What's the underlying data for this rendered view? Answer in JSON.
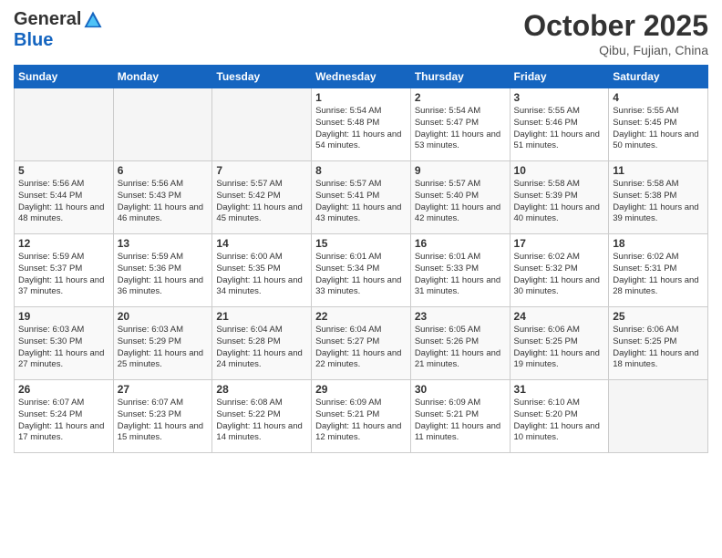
{
  "header": {
    "logo_line1": "General",
    "logo_line2": "Blue",
    "month": "October 2025",
    "location": "Qibu, Fujian, China"
  },
  "days_of_week": [
    "Sunday",
    "Monday",
    "Tuesday",
    "Wednesday",
    "Thursday",
    "Friday",
    "Saturday"
  ],
  "weeks": [
    [
      {
        "day": "",
        "empty": true
      },
      {
        "day": "",
        "empty": true
      },
      {
        "day": "",
        "empty": true
      },
      {
        "day": "1",
        "sunrise": "5:54 AM",
        "sunset": "5:48 PM",
        "daylight": "11 hours and 54 minutes."
      },
      {
        "day": "2",
        "sunrise": "5:54 AM",
        "sunset": "5:47 PM",
        "daylight": "11 hours and 53 minutes."
      },
      {
        "day": "3",
        "sunrise": "5:55 AM",
        "sunset": "5:46 PM",
        "daylight": "11 hours and 51 minutes."
      },
      {
        "day": "4",
        "sunrise": "5:55 AM",
        "sunset": "5:45 PM",
        "daylight": "11 hours and 50 minutes."
      }
    ],
    [
      {
        "day": "5",
        "sunrise": "5:56 AM",
        "sunset": "5:44 PM",
        "daylight": "11 hours and 48 minutes."
      },
      {
        "day": "6",
        "sunrise": "5:56 AM",
        "sunset": "5:43 PM",
        "daylight": "11 hours and 46 minutes."
      },
      {
        "day": "7",
        "sunrise": "5:57 AM",
        "sunset": "5:42 PM",
        "daylight": "11 hours and 45 minutes."
      },
      {
        "day": "8",
        "sunrise": "5:57 AM",
        "sunset": "5:41 PM",
        "daylight": "11 hours and 43 minutes."
      },
      {
        "day": "9",
        "sunrise": "5:57 AM",
        "sunset": "5:40 PM",
        "daylight": "11 hours and 42 minutes."
      },
      {
        "day": "10",
        "sunrise": "5:58 AM",
        "sunset": "5:39 PM",
        "daylight": "11 hours and 40 minutes."
      },
      {
        "day": "11",
        "sunrise": "5:58 AM",
        "sunset": "5:38 PM",
        "daylight": "11 hours and 39 minutes."
      }
    ],
    [
      {
        "day": "12",
        "sunrise": "5:59 AM",
        "sunset": "5:37 PM",
        "daylight": "11 hours and 37 minutes."
      },
      {
        "day": "13",
        "sunrise": "5:59 AM",
        "sunset": "5:36 PM",
        "daylight": "11 hours and 36 minutes."
      },
      {
        "day": "14",
        "sunrise": "6:00 AM",
        "sunset": "5:35 PM",
        "daylight": "11 hours and 34 minutes."
      },
      {
        "day": "15",
        "sunrise": "6:01 AM",
        "sunset": "5:34 PM",
        "daylight": "11 hours and 33 minutes."
      },
      {
        "day": "16",
        "sunrise": "6:01 AM",
        "sunset": "5:33 PM",
        "daylight": "11 hours and 31 minutes."
      },
      {
        "day": "17",
        "sunrise": "6:02 AM",
        "sunset": "5:32 PM",
        "daylight": "11 hours and 30 minutes."
      },
      {
        "day": "18",
        "sunrise": "6:02 AM",
        "sunset": "5:31 PM",
        "daylight": "11 hours and 28 minutes."
      }
    ],
    [
      {
        "day": "19",
        "sunrise": "6:03 AM",
        "sunset": "5:30 PM",
        "daylight": "11 hours and 27 minutes."
      },
      {
        "day": "20",
        "sunrise": "6:03 AM",
        "sunset": "5:29 PM",
        "daylight": "11 hours and 25 minutes."
      },
      {
        "day": "21",
        "sunrise": "6:04 AM",
        "sunset": "5:28 PM",
        "daylight": "11 hours and 24 minutes."
      },
      {
        "day": "22",
        "sunrise": "6:04 AM",
        "sunset": "5:27 PM",
        "daylight": "11 hours and 22 minutes."
      },
      {
        "day": "23",
        "sunrise": "6:05 AM",
        "sunset": "5:26 PM",
        "daylight": "11 hours and 21 minutes."
      },
      {
        "day": "24",
        "sunrise": "6:06 AM",
        "sunset": "5:25 PM",
        "daylight": "11 hours and 19 minutes."
      },
      {
        "day": "25",
        "sunrise": "6:06 AM",
        "sunset": "5:25 PM",
        "daylight": "11 hours and 18 minutes."
      }
    ],
    [
      {
        "day": "26",
        "sunrise": "6:07 AM",
        "sunset": "5:24 PM",
        "daylight": "11 hours and 17 minutes."
      },
      {
        "day": "27",
        "sunrise": "6:07 AM",
        "sunset": "5:23 PM",
        "daylight": "11 hours and 15 minutes."
      },
      {
        "day": "28",
        "sunrise": "6:08 AM",
        "sunset": "5:22 PM",
        "daylight": "11 hours and 14 minutes."
      },
      {
        "day": "29",
        "sunrise": "6:09 AM",
        "sunset": "5:21 PM",
        "daylight": "11 hours and 12 minutes."
      },
      {
        "day": "30",
        "sunrise": "6:09 AM",
        "sunset": "5:21 PM",
        "daylight": "11 hours and 11 minutes."
      },
      {
        "day": "31",
        "sunrise": "6:10 AM",
        "sunset": "5:20 PM",
        "daylight": "11 hours and 10 minutes."
      },
      {
        "day": "",
        "empty": true
      }
    ]
  ]
}
